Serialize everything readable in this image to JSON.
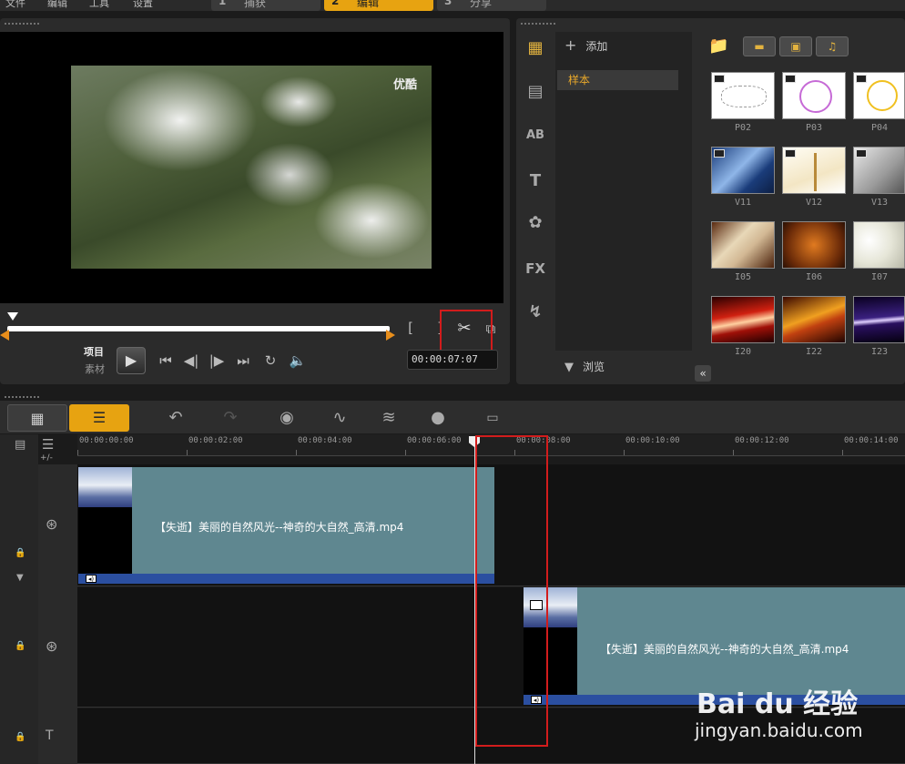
{
  "menu": {
    "file": "文件",
    "edit": "编辑",
    "tools": "工具",
    "settings": "设置"
  },
  "steps": [
    {
      "num": "1",
      "label": "捕获"
    },
    {
      "num": "2",
      "label": "编辑"
    },
    {
      "num": "3",
      "label": "分享"
    }
  ],
  "preview": {
    "watermark": "优酷",
    "mode_project": "项目",
    "mode_clip": "素材",
    "timecode": "00:00:07:07",
    "mark_in": "[",
    "mark_out": "]"
  },
  "library": {
    "add_label": "添加",
    "folder": "样本",
    "browse_label": "浏览",
    "thumbnails": [
      {
        "label": "P02"
      },
      {
        "label": "P03"
      },
      {
        "label": "P04"
      },
      {
        "label": "V11"
      },
      {
        "label": "V12"
      },
      {
        "label": "V13"
      },
      {
        "label": "I05"
      },
      {
        "label": "I06"
      },
      {
        "label": "I07"
      },
      {
        "label": "I20"
      },
      {
        "label": "I22"
      },
      {
        "label": "I23"
      }
    ]
  },
  "timeline": {
    "zoom_label": "+/-",
    "ruler": [
      "00:00:00:00",
      "00:00:02:00",
      "00:00:04:00",
      "00:00:06:00",
      "00:00:08:00",
      "00:00:10:00",
      "00:00:12:00",
      "00:00:14:00"
    ],
    "clip1_name": "【失逝】美丽的自然风光--神奇的大自然_高清.mp4",
    "clip2_name": "【失逝】美丽的自然风光--神奇的大自然_高清.mp4"
  },
  "watermark": {
    "baidu": "Bai du 经验",
    "site": "jingyan.baidu.com"
  },
  "colors": {
    "accent": "#e7a311",
    "highlight_box": "#d21c1c",
    "clip": "#5f8790",
    "audio_bar": "#2b4fa0"
  }
}
